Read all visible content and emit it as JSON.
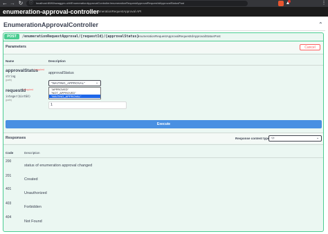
{
  "browser": {
    "url": "localhost:8080/swagger-ui/#/EnumerationApprovalController/enumerationRequestApprovalRequestIdApprovalStatusPost",
    "back_icon": "arrow-left-icon",
    "forward_icon": "arrow-right-icon",
    "reload_icon": "reload-icon",
    "lock_icon": "info-icon",
    "menu_icon": "kebab-menu-icon",
    "extension_badge": "2",
    "colors": {
      "chrome": "#35363a",
      "urlbar": "#202124"
    }
  },
  "controller_header": {
    "title": "enumeration-approval-controller",
    "description": "the enumerationRequestApproval API"
  },
  "section": {
    "title": "EnumerationApprovalController",
    "chevron_icon": "chevron-up-icon"
  },
  "operation": {
    "method": "POST",
    "path": "/enumerationRequestApproval/{requestId}/{approvalStatus}",
    "operation_id": "enumerationRequestApprovalRequestIdApprovalStatusPost",
    "colors": {
      "method": "#49cc90",
      "background": "#ebf7f2"
    }
  },
  "parameters": {
    "label": "Parameters",
    "cancel_label": "Cancel",
    "col_name": "Name",
    "col_description": "Description",
    "items": [
      {
        "name": "approvalStatus",
        "required": "* required",
        "type": "string",
        "in": "(path)",
        "description": "approvalStatus",
        "selected": "\"WAITING_APPROVAL\"",
        "options": [
          "\"APPROVED\"",
          "\"NOT_APPROVED\"",
          "\"WAITING_APPROVAL\""
        ]
      },
      {
        "name": "requestId",
        "required": "* required",
        "type": "integer($int64)",
        "in": "(path)",
        "value": "1"
      }
    ]
  },
  "execute_label": "Execute",
  "responses": {
    "label": "Responses",
    "content_type_label": "Response content type",
    "content_type_value": "*/*",
    "col_code": "Code",
    "col_description": "Description",
    "items": [
      {
        "code": "200",
        "description": "status of enumeration approval changed"
      },
      {
        "code": "201",
        "description": "Created"
      },
      {
        "code": "401",
        "description": "Unauthorized"
      },
      {
        "code": "403",
        "description": "Forbidden"
      },
      {
        "code": "404",
        "description": "Not Found"
      }
    ]
  }
}
